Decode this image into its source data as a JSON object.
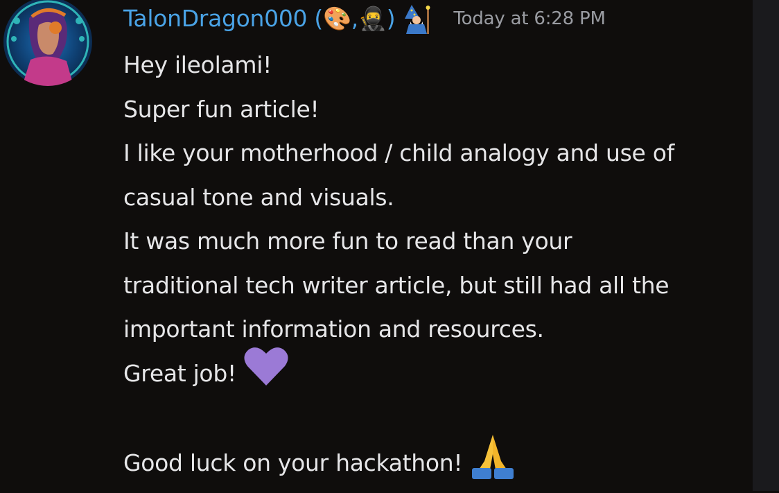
{
  "message": {
    "author": "TalonDragon000 (🎨,🥷)",
    "role_icon": "wizard-emoji",
    "timestamp": "Today at 6:28 PM",
    "lines": [
      "Hey ileolami!",
      "Super fun article!",
      "I like your motherhood / child analogy and use of",
      "casual tone and visuals.",
      "It was much more fun to read than your",
      "traditional tech writer article, but still had all the",
      "important information and resources.",
      "Great job!",
      "",
      "Good luck on your hackathon!"
    ],
    "line_emojis": {
      "great_job": "purple-heart-emoji",
      "good_luck": "folded-hands-emoji"
    }
  },
  "colors": {
    "background": "#0f0d0c",
    "username": "#4aa3e6",
    "text": "#e6e6e8",
    "timestamp": "#9a9ca2",
    "scroll_track": "#1a1a1d",
    "heart": "#9b7ad6"
  }
}
